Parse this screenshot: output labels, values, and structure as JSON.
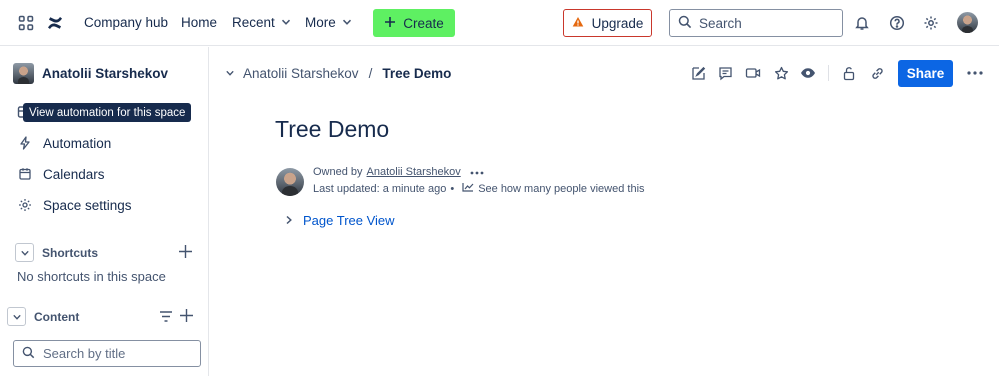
{
  "topbar": {
    "app_name": "Company hub",
    "nav": {
      "home": "Home",
      "recent": "Recent",
      "more": "More"
    },
    "create_label": "Create",
    "upgrade_label": "Upgrade",
    "search_placeholder": "Search"
  },
  "sidebar": {
    "space_name": "Anatolii Starshekov",
    "tooltip": "View automation for this space",
    "items": [
      {
        "label": "Automation",
        "icon": "lightning-icon"
      },
      {
        "label": "Calendars",
        "icon": "calendar-icon"
      },
      {
        "label": "Space settings",
        "icon": "gear-icon"
      }
    ],
    "shortcuts": {
      "title": "Shortcuts",
      "empty_text": "No shortcuts in this space"
    },
    "content": {
      "title": "Content",
      "search_placeholder": "Search by title"
    }
  },
  "main": {
    "breadcrumb": {
      "parent": "Anatolii Starshekov",
      "separator": "/",
      "current": "Tree Demo"
    },
    "share_label": "Share",
    "page_title": "Tree Demo",
    "byline": {
      "owned_by_prefix": "Owned by",
      "owner": "Anatolii Starshekov",
      "last_updated": "Last updated: a minute ago",
      "views_text": "See how many people viewed this"
    },
    "tree_link": "Page Tree View"
  },
  "colors": {
    "create_button": "#5ef062",
    "share_button": "#0c66e4",
    "upgrade_border": "#c9372c",
    "link": "#0055cc"
  }
}
